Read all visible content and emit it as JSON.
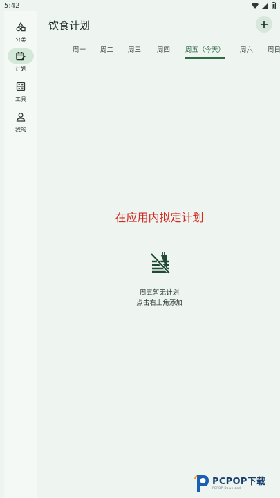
{
  "status_bar": {
    "time": "5:42"
  },
  "nav": {
    "items": [
      {
        "label": "分类",
        "icon": "shapes-icon",
        "active": false
      },
      {
        "label": "计划",
        "icon": "calendar-edit-icon",
        "active": true
      },
      {
        "label": "工具",
        "icon": "toolbox-icon",
        "active": false
      },
      {
        "label": "我的",
        "icon": "person-icon",
        "active": false
      }
    ]
  },
  "header": {
    "title": "饮食计划",
    "add_icon": "plus-icon"
  },
  "tabs": [
    {
      "label": "周一"
    },
    {
      "label": "周二"
    },
    {
      "label": "周三"
    },
    {
      "label": "周四"
    },
    {
      "label": "周五（今天）",
      "active": true
    },
    {
      "label": "周六"
    },
    {
      "label": "周日"
    }
  ],
  "main": {
    "overlay_text": "在应用内拟定计划",
    "empty_icon": "no-food-icon",
    "empty_line1": "周五暂无计划",
    "empty_line2": "点击右上角添加"
  },
  "watermark": {
    "brand": "PCPOP下载",
    "sub": "PCPOP Download"
  },
  "colors": {
    "accent": "#2f6d47",
    "background": "#eef4ef",
    "overlay_red": "#d42a22"
  }
}
